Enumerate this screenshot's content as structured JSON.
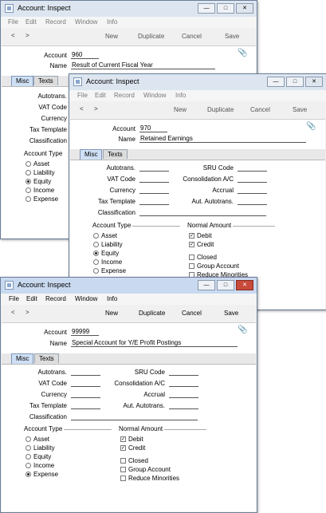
{
  "windows": [
    {
      "title": "Account: Inspect",
      "menu": [
        "File",
        "Edit",
        "Record",
        "Window",
        "Info"
      ],
      "nav": {
        "back": "<",
        "forward": ">"
      },
      "toolbar": {
        "new": "New",
        "duplicate": "Duplicate",
        "cancel": "Cancel",
        "save": "Save"
      },
      "account_label": "Account",
      "account_value": "960",
      "name_label": "Name",
      "name_value": "Result of Current Fiscal Year",
      "tabs": {
        "misc": "Misc",
        "texts": "Texts"
      },
      "labels": {
        "autotrans": "Autotrans.",
        "vat": "VAT Code",
        "currency": "Currency",
        "tax_template": "Tax Template",
        "classification": "Classification"
      },
      "account_type": {
        "header": "Account Type",
        "options": [
          "Asset",
          "Liability",
          "Equity",
          "Income",
          "Expense"
        ],
        "selected": "Equity"
      }
    },
    {
      "title": "Account: Inspect",
      "menu": [
        "File",
        "Edit",
        "Record",
        "Window",
        "Info"
      ],
      "nav": {
        "back": "<",
        "forward": ">"
      },
      "toolbar": {
        "new": "New",
        "duplicate": "Duplicate",
        "cancel": "Cancel",
        "save": "Save"
      },
      "account_label": "Account",
      "account_value": "970",
      "name_label": "Name",
      "name_value": "Retained Earnings",
      "tabs": {
        "misc": "Misc",
        "texts": "Texts"
      },
      "labels": {
        "autotrans": "Autotrans.",
        "vat": "VAT Code",
        "currency": "Currency",
        "tax_template": "Tax Template",
        "classification": "Classification",
        "sru": "SRU Code",
        "consolidation": "Consolidation A/C",
        "accrual": "Accrual",
        "aut_autotrans": "Aut. Autotrans."
      },
      "account_type": {
        "header": "Account Type",
        "options": [
          "Asset",
          "Liability",
          "Equity",
          "Income",
          "Expense"
        ],
        "selected": "Equity"
      },
      "normal_amount": {
        "header": "Normal Amount",
        "debit": "Debit",
        "credit": "Credit",
        "debit_checked": true,
        "credit_checked": true
      },
      "flags": {
        "closed": "Closed",
        "group_account": "Group Account",
        "reduce_minorities": "Reduce Minorities"
      }
    },
    {
      "title": "Account: Inspect",
      "menu": [
        "File",
        "Edit",
        "Record",
        "Window",
        "Info"
      ],
      "nav": {
        "back": "<",
        "forward": ">"
      },
      "toolbar": {
        "new": "New",
        "duplicate": "Duplicate",
        "cancel": "Cancel",
        "save": "Save"
      },
      "account_label": "Account",
      "account_value": "99999",
      "name_label": "Name",
      "name_value": "Special Account for Y/E Profit Postings",
      "tabs": {
        "misc": "Misc",
        "texts": "Texts"
      },
      "labels": {
        "autotrans": "Autotrans.",
        "vat": "VAT Code",
        "currency": "Currency",
        "tax_template": "Tax Template",
        "classification": "Classification",
        "sru": "SRU Code",
        "consolidation": "Consolidation A/C",
        "accrual": "Accrual",
        "aut_autotrans": "Aut. Autotrans."
      },
      "account_type": {
        "header": "Account Type",
        "options": [
          "Asset",
          "Liability",
          "Equity",
          "Income",
          "Expense"
        ],
        "selected": "Expense"
      },
      "normal_amount": {
        "header": "Normal Amount",
        "debit": "Debit",
        "credit": "Credit",
        "debit_checked": true,
        "credit_checked": true
      },
      "flags": {
        "closed": "Closed",
        "group_account": "Group Account",
        "reduce_minorities": "Reduce Minorities"
      }
    }
  ]
}
